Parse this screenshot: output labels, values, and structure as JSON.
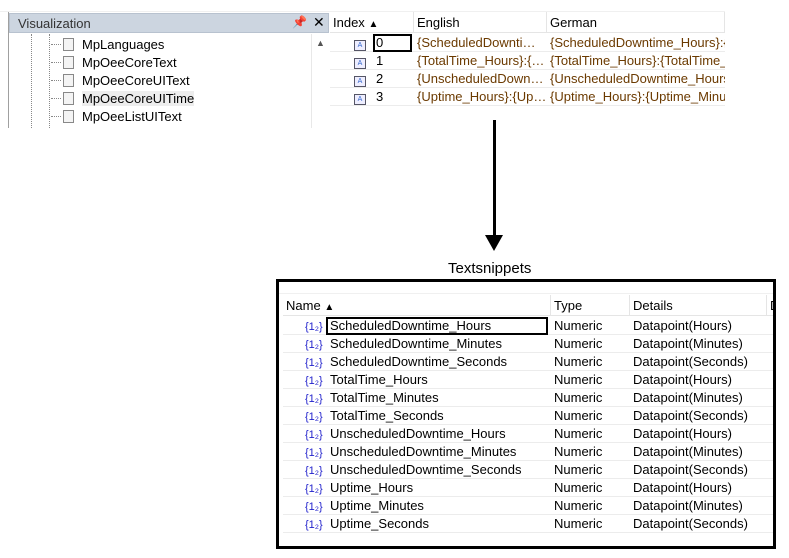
{
  "panel": {
    "title": "Visualization",
    "pin_icon": "pin-icon",
    "close_icon": "close-icon",
    "items": [
      {
        "label": "MpLanguages"
      },
      {
        "label": "MpOeeCoreText"
      },
      {
        "label": "MpOeeCoreUIText"
      },
      {
        "label": "MpOeeCoreUITime",
        "selected": true
      },
      {
        "label": "MpOeeListUIText"
      }
    ]
  },
  "text_table": {
    "columns": [
      "Index",
      "English",
      "German"
    ],
    "sort_indicator": "▲",
    "rows": [
      {
        "index": "0",
        "english": "{ScheduledDownti…",
        "german": "{ScheduledDowntime_Hours}:{"
      },
      {
        "index": "1",
        "english": "{TotalTime_Hours}:{…",
        "german": "{TotalTime_Hours}:{TotalTime_"
      },
      {
        "index": "2",
        "english": "{UnscheduledDown…",
        "german": "{UnscheduledDowntime_Hours"
      },
      {
        "index": "3",
        "english": "{Uptime_Hours}:{Up…",
        "german": "{Uptime_Hours}:{Uptime_Minut"
      }
    ]
  },
  "snippets": {
    "label": "Textsnippets",
    "columns": [
      "Name",
      "Type",
      "Details",
      "D"
    ],
    "sort_indicator": "▲",
    "icon_glyph": "{1₂}",
    "rows": [
      {
        "name": "ScheduledDowntime_Hours",
        "type": "Numeric",
        "details": "Datapoint(Hours)"
      },
      {
        "name": "ScheduledDowntime_Minutes",
        "type": "Numeric",
        "details": "Datapoint(Minutes)"
      },
      {
        "name": "ScheduledDowntime_Seconds",
        "type": "Numeric",
        "details": "Datapoint(Seconds)"
      },
      {
        "name": "TotalTime_Hours",
        "type": "Numeric",
        "details": "Datapoint(Hours)"
      },
      {
        "name": "TotalTime_Minutes",
        "type": "Numeric",
        "details": "Datapoint(Minutes)"
      },
      {
        "name": "TotalTime_Seconds",
        "type": "Numeric",
        "details": "Datapoint(Seconds)"
      },
      {
        "name": "UnscheduledDowntime_Hours",
        "type": "Numeric",
        "details": "Datapoint(Hours)"
      },
      {
        "name": "UnscheduledDowntime_Minutes",
        "type": "Numeric",
        "details": "Datapoint(Minutes)"
      },
      {
        "name": "UnscheduledDowntime_Seconds",
        "type": "Numeric",
        "details": "Datapoint(Seconds)"
      },
      {
        "name": "Uptime_Hours",
        "type": "Numeric",
        "details": "Datapoint(Hours)"
      },
      {
        "name": "Uptime_Minutes",
        "type": "Numeric",
        "details": "Datapoint(Minutes)"
      },
      {
        "name": "Uptime_Seconds",
        "type": "Numeric",
        "details": "Datapoint(Seconds)"
      }
    ]
  },
  "colors": {
    "panel_header": "#ccd5e0",
    "string_text": "#6b3a00",
    "numeric_icon": "#2222cc"
  }
}
